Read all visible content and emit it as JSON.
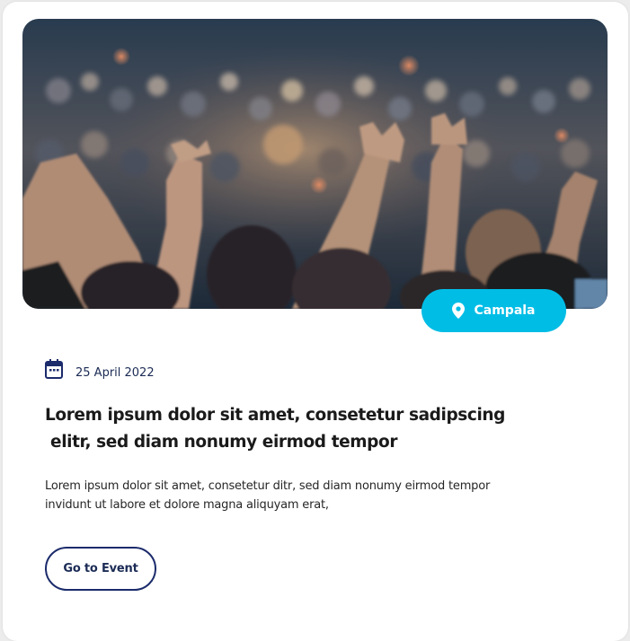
{
  "event": {
    "location": "Campala",
    "date": "25 April 2022",
    "title_lines": [
      "Lorem ipsum dolor sit amet, consetetur sadipscing",
      " elitr, sed diam nonumy eirmod tempor"
    ],
    "description_lines": [
      "Lorem ipsum dolor sit amet, consetetur ditr, sed diam nonumy eirmod tempor",
      "invidunt ut labore et dolore magna aliquyam erat,"
    ],
    "cta_label": "Go to Event"
  },
  "icons": {
    "location": "map-pin-icon",
    "date": "calendar-icon"
  },
  "colors": {
    "accent": "#00bde6",
    "navy": "#1b2b6b",
    "text": "#1a1a1a"
  }
}
